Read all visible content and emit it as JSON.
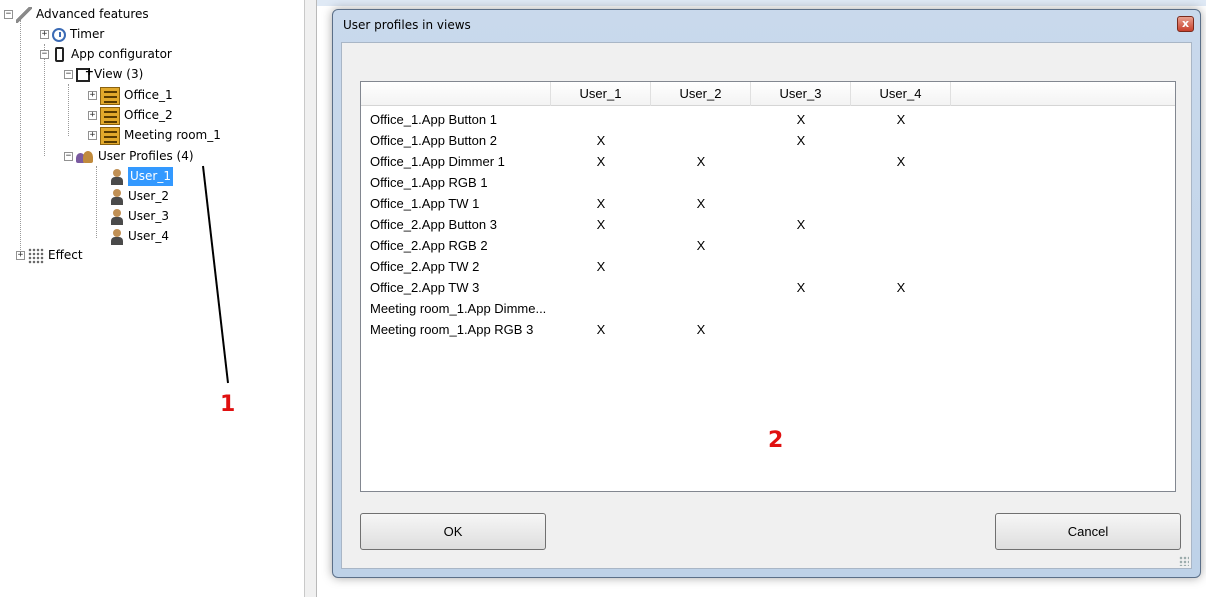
{
  "tree": {
    "root_label": "Advanced features",
    "timer_label": "Timer",
    "app_configurator_label": "App configurator",
    "view_label": "View (3)",
    "views": [
      "Office_1",
      "Office_2",
      "Meeting room_1"
    ],
    "user_profiles_label": "User Profiles (4)",
    "users": [
      "User_1",
      "User_2",
      "User_3",
      "User_4"
    ],
    "selected_user": "User_1",
    "effect_label": "Effect"
  },
  "callouts": {
    "one": "1",
    "two": "2"
  },
  "dialog": {
    "title": "User profiles in views",
    "close_glyph": "x",
    "columns": [
      "User_1",
      "User_2",
      "User_3",
      "User_4"
    ],
    "rows": [
      {
        "name": "Office_1.App Button 1",
        "marks": [
          "",
          "",
          "X",
          "X"
        ]
      },
      {
        "name": "Office_1.App Button 2",
        "marks": [
          "X",
          "",
          "X",
          ""
        ]
      },
      {
        "name": "Office_1.App Dimmer 1",
        "marks": [
          "X",
          "X",
          "",
          "X"
        ]
      },
      {
        "name": "Office_1.App RGB 1",
        "marks": [
          "",
          "",
          "",
          ""
        ]
      },
      {
        "name": "Office_1.App TW 1",
        "marks": [
          "X",
          "X",
          "",
          ""
        ]
      },
      {
        "name": "Office_2.App Button 3",
        "marks": [
          "X",
          "",
          "X",
          ""
        ]
      },
      {
        "name": "Office_2.App RGB 2",
        "marks": [
          "",
          "X",
          "",
          ""
        ]
      },
      {
        "name": "Office_2.App TW 2",
        "marks": [
          "X",
          "",
          "",
          ""
        ]
      },
      {
        "name": "Office_2.App TW 3",
        "marks": [
          "",
          "",
          "X",
          "X"
        ]
      },
      {
        "name": "Meeting room_1.App Dimme...",
        "marks": [
          "",
          "",
          "",
          ""
        ]
      },
      {
        "name": "Meeting room_1.App RGB 3",
        "marks": [
          "X",
          "X",
          "",
          ""
        ]
      }
    ],
    "ok_label": "OK",
    "cancel_label": "Cancel"
  },
  "colors": {
    "selection": "#3399ff",
    "callout": "#e01010",
    "dialog_frame": "#c9d9ec"
  }
}
